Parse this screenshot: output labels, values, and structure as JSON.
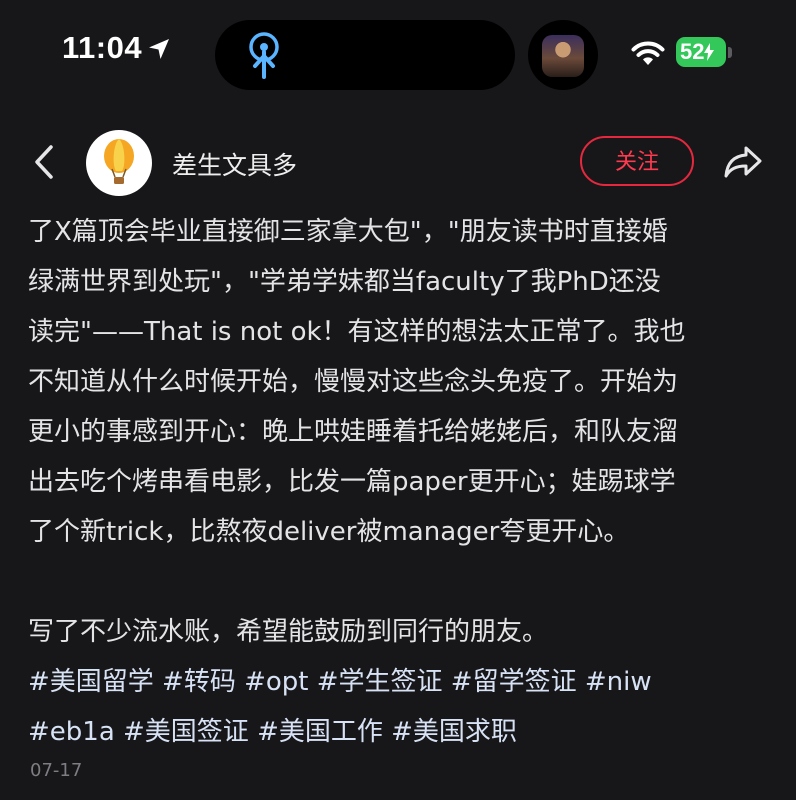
{
  "status_bar": {
    "time": "11:04",
    "battery": "52"
  },
  "header": {
    "author_name": "差生文具多",
    "follow_label": "关注"
  },
  "post": {
    "lines": [
      "了X篇顶会毕业直接御三家拿大包\"，\"朋友读书时直接婚",
      "绿满世界到处玩\"，\"学弟学妹都当faculty了我PhD还没",
      "读完\"——That is not ok！有这样的想法太正常了。我也",
      "不知道从什么时候开始，慢慢对这些念头免疫了。开始为",
      "更小的事感到开心：晚上哄娃睡着托给姥姥后，和队友溜",
      "出去吃个烤串看电影，比发一篇paper更开心；娃踢球学",
      "了个新trick，比熬夜deliver被manager夸更开心。"
    ],
    "closing": "写了不少流水账，希望能鼓励到同行的朋友。",
    "tag_lines": [
      "#美国留学 #转码 #opt #学生签证 #留学签证 #niw",
      "#eb1a #美国签证 #美国工作 #美国求职"
    ],
    "date": "07-17"
  },
  "icons": {
    "location": "location-arrow-icon",
    "island_activity": "accessibility-touch-icon",
    "wifi": "wifi-icon",
    "back": "chevron-left-icon",
    "avatar": "hot-air-balloon-icon",
    "share": "share-arrow-icon"
  },
  "colors": {
    "background": "#17171a",
    "follow_red": "#e6283e",
    "battery_green": "#34c759",
    "tag_text": "#d7e2f5"
  }
}
